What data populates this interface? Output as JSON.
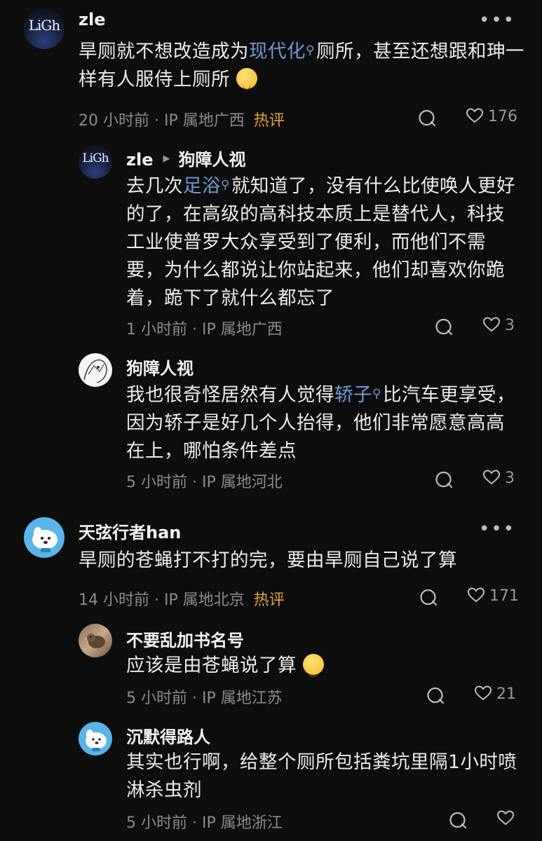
{
  "comments": [
    {
      "author": "zle",
      "avatar_text": "LiGh",
      "text_parts": [
        "旱厕就不想改造成为",
        "现代化",
        "厕所，甚至还想跟和珅一样有人服侍上厕所"
      ],
      "time": "20 小时前",
      "location": "IP 属地广西",
      "hot_badge": "热评",
      "likes": "176"
    },
    {
      "author": "zle",
      "reply_to": "狗障人视",
      "avatar_text": "LiGh",
      "text_parts": [
        "去几次",
        "足浴",
        "就知道了，没有什么比使唤人更好的了，在高级的高科技本质上是替代人，科技工业使普罗大众享受到了便利，而他们不需要，为什么都说让你站起来，他们却喜欢你跪着，跪下了就什么都忘了"
      ],
      "time": "1 小时前",
      "location": "IP 属地广西",
      "likes": "3"
    },
    {
      "author": "狗障人视",
      "text_parts": [
        "我也很奇怪居然有人觉得",
        "轿子",
        "比汽车更享受，因为轿子是好几个人抬得，他们非常愿意高高在上，哪怕条件差点"
      ],
      "time": "5 小时前",
      "location": "IP 属地河北",
      "likes": "3"
    },
    {
      "author": "天弦行者han",
      "text": "旱厕的苍蝇打不打的完，要由旱厕自己说了算",
      "time": "14 小时前",
      "location": "IP 属地北京",
      "hot_badge": "热评",
      "likes": "171"
    },
    {
      "author": "不要乱加书名号",
      "text": "应该是由苍蝇说了算",
      "time": "5 小时前",
      "location": "IP 属地江苏",
      "likes": "21"
    },
    {
      "author": "沉默得路人",
      "text": "其实也行啊，给整个厕所包括粪坑里隔1小时喷淋杀虫剂",
      "time": "5 小时前",
      "location": "IP 属地浙江",
      "likes": ""
    }
  ],
  "meta_separator": "·",
  "link_search_icon": "search-mini-icon",
  "colors": {
    "background": "#0d0d0d",
    "link": "#6f9bd6",
    "hot": "#e3a63c",
    "meta": "#8c8c8c"
  }
}
